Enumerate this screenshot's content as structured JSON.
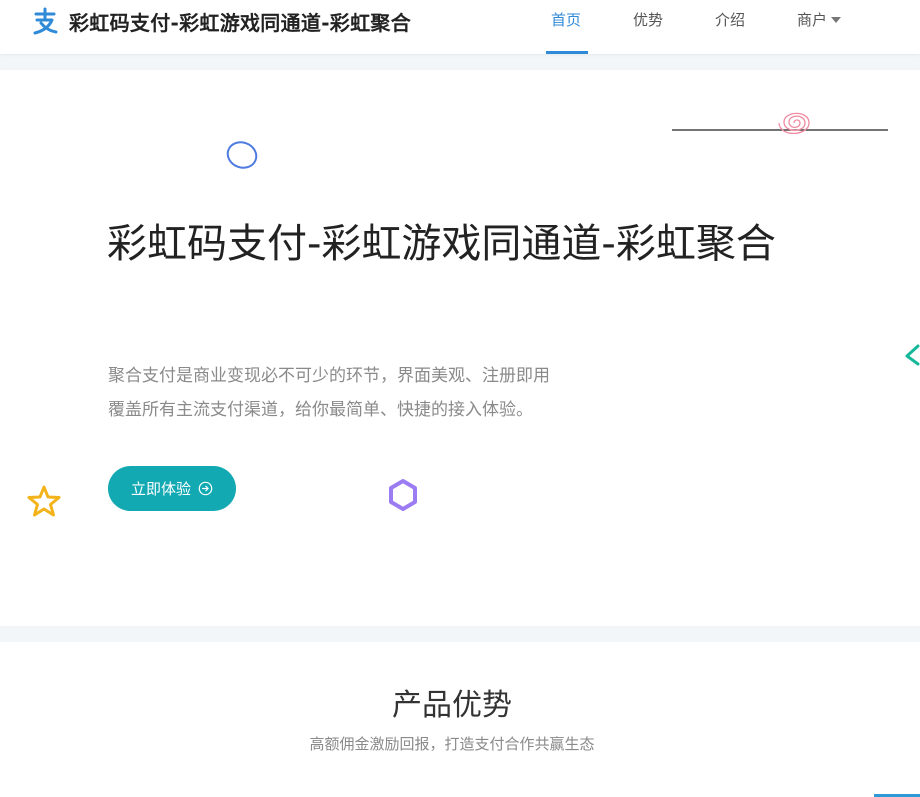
{
  "brand": {
    "logo_glyph": "支",
    "name": "彩虹码支付-彩虹游戏同通道-彩虹聚合",
    "logo_color": "#2f8ad8"
  },
  "nav": {
    "items": [
      {
        "label": "首页",
        "active": true
      },
      {
        "label": "优势",
        "active": false
      },
      {
        "label": "介绍",
        "active": false
      },
      {
        "label": "商户",
        "active": false,
        "has_dropdown": true
      }
    ],
    "accent_color": "#2f8ad8"
  },
  "hero": {
    "title": "彩虹码支付-彩虹游戏同通道-彩虹聚合",
    "desc_line1": "聚合支付是商业变现必不可少的环节，界面美观、注册即用",
    "desc_line2": "覆盖所有主流支付渠道，给你最简单、快捷的接入体验。",
    "cta_label": "立即体验",
    "cta_icon": "arrow-right-circle-icon",
    "cta_color": "#12a9b3"
  },
  "features": {
    "title": "产品优势",
    "subtitle": "高额佣金激励回报，打造支付合作共赢生态"
  }
}
